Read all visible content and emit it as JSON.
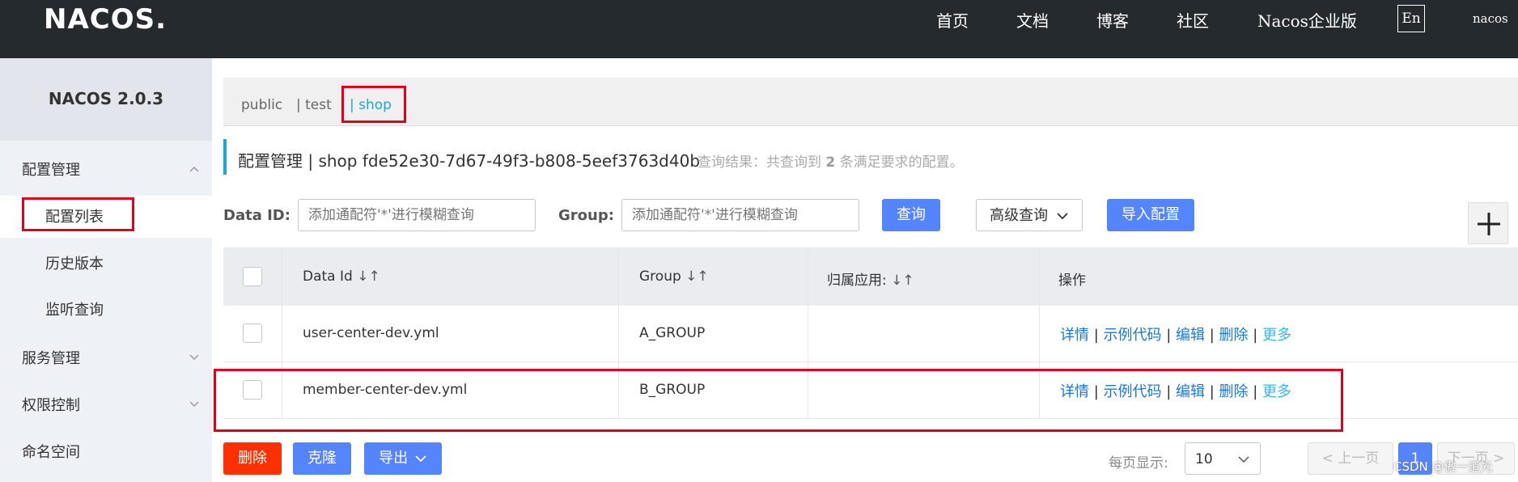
{
  "header": {
    "logo": "NACOS.",
    "nav": [
      "首页",
      "文档",
      "博客",
      "社区",
      "Nacos企业版"
    ],
    "lang": "En",
    "user": "nacos"
  },
  "sidebar": {
    "version": "NACOS 2.0.3",
    "groups": [
      {
        "label": "配置管理",
        "chevron": "up"
      },
      {
        "label": "服务管理",
        "chevron": "down"
      },
      {
        "label": "权限控制",
        "chevron": "down"
      },
      {
        "label": "命名空间"
      }
    ],
    "sub_items": [
      "配置列表",
      "历史版本",
      "监听查询"
    ]
  },
  "namespaces": [
    "public",
    "| test",
    "| shop"
  ],
  "title": {
    "text": "配置管理 | shop fde52e30-7d67-49f3-b808-5eef3763d40b",
    "hint_prefix": "查询结果：共查询到",
    "hint_count": "2",
    "hint_suffix": "条满足要求的配置。"
  },
  "filters": {
    "data_id_label": "Data ID:",
    "data_id_placeholder": "添加通配符'*'进行模糊查询",
    "group_label": "Group:",
    "group_placeholder": "添加通配符'*'进行模糊查询",
    "query": "查询",
    "advanced": "高级查询",
    "import": "导入配置"
  },
  "table": {
    "headers": [
      "Data Id",
      "Group",
      "归属应用:",
      "操作"
    ],
    "rows": [
      {
        "data_id": "user-center-dev.yml",
        "group": "A_GROUP",
        "app": ""
      },
      {
        "data_id": "member-center-dev.yml",
        "group": "B_GROUP",
        "app": ""
      }
    ],
    "ops": [
      "详情",
      "示例代码",
      "编辑",
      "删除",
      "更多"
    ]
  },
  "footer": {
    "delete": "删除",
    "clone": "克隆",
    "export": "导出",
    "page_size_label": "每页显示:",
    "page_size": "10",
    "prev": "< 上一页",
    "page": "1",
    "next": "下一页 >"
  },
  "watermark": "CSDN @傲一道光",
  "colors": {
    "accent": "#5584ff",
    "danger": "#ff3000",
    "link": "#1a78d2",
    "highlight": "#e1001b"
  }
}
